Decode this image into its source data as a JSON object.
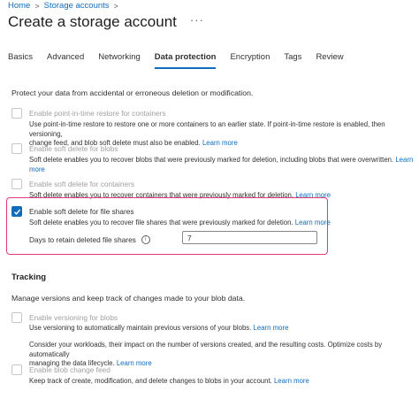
{
  "breadcrumb": {
    "home": "Home",
    "storage": "Storage accounts"
  },
  "title": "Create a storage account",
  "more_label": "···",
  "tabs": [
    {
      "label": "Basics"
    },
    {
      "label": "Advanced"
    },
    {
      "label": "Networking"
    },
    {
      "label": "Data protection",
      "active": true
    },
    {
      "label": "Encryption"
    },
    {
      "label": "Tags"
    },
    {
      "label": "Review"
    }
  ],
  "intro": "Protect your data from accidental or erroneous deletion or modification.",
  "options": {
    "pitr": {
      "label": "Enable point-in-time restore for containers",
      "desc1": "Use point-in-time restore to restore one or more containers to an earlier state. If point-in-time restore is enabled, then versioning,",
      "desc2": "change feed, and blob soft delete must also be enabled.",
      "learn": "Learn more",
      "checked": false,
      "enabled": false
    },
    "blob_soft": {
      "label": "Enable soft delete for blobs",
      "desc1": "Soft delete enables you to recover blobs that were previously marked for deletion, including blobs that were overwritten.",
      "learn": "Learn",
      "learn2": "more",
      "checked": false,
      "enabled": false
    },
    "container_soft": {
      "label": "Enable soft delete for containers",
      "desc1": "Soft delete enables you to recover containers that were previously marked for deletion.",
      "learn": "Learn more",
      "checked": false,
      "enabled": false
    },
    "file_soft": {
      "label": "Enable soft delete for file shares",
      "desc1": "Soft delete enables you to recover file shares that were previously marked for deletion.",
      "learn": "Learn more",
      "checked": true,
      "enabled": true
    }
  },
  "retention": {
    "label": "Days to retain deleted file shares",
    "info_icon": "info-icon",
    "value": "7"
  },
  "tracking": {
    "title": "Tracking",
    "intro": "Manage versions and keep track of changes made to your blob data.",
    "versioning": {
      "label": "Enable versioning for blobs",
      "desc1": "Use versioning to automatically maintain previous versions of your blobs.",
      "learn": "Learn more",
      "desc2": "Consider your workloads, their impact on the number of versions created, and the resulting costs. Optimize costs by automatically",
      "desc3": "managing the data lifecycle.",
      "learn2": "Learn more",
      "checked": false,
      "enabled": false
    },
    "change_feed": {
      "label": "Enable blob change feed",
      "desc1": "Keep track of create, modification, and delete changes to blobs in your account.",
      "learn": "Learn more",
      "checked": false,
      "enabled": false
    }
  },
  "colors": {
    "accent": "#0f6cbd",
    "highlight": "#e3387a"
  }
}
